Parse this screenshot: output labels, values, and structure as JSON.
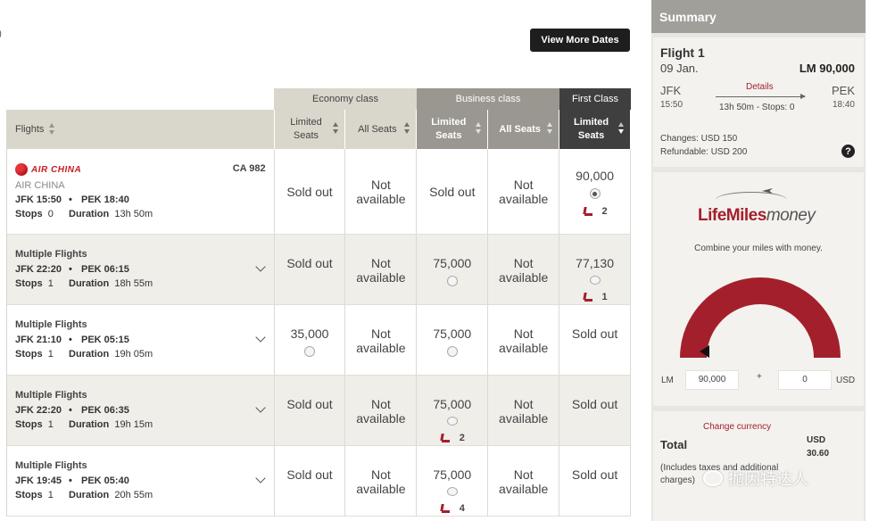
{
  "paren": ")",
  "view_more_label": "View More Dates",
  "classes": {
    "economy": "Economy class",
    "business": "Business class",
    "first": "First Class"
  },
  "columns": {
    "flights": "Flights",
    "eco_limited": "Limited Seats",
    "eco_all": "All Seats",
    "bus_limited": "Limited Seats",
    "bus_all": "All Seats",
    "first_limited": "Limited Seats"
  },
  "colors": {
    "accent_red": "#a41f2c",
    "dark": "#3f3f3f",
    "business_grey": "#9a9790",
    "economy_beige": "#d9d6cc"
  },
  "rows": [
    {
      "airline_logo_text": "AIR CHINA",
      "airline_name": "AIR CHINA",
      "flight_no": "CA 982",
      "dep": "JFK 15:50",
      "arr": "PEK 18:40",
      "stops_label": "Stops",
      "stops": "0",
      "duration_label": "Duration",
      "duration": "13h 50m",
      "cells": [
        "Sold out",
        "Not available",
        "Sold out",
        "Not available",
        "90,000"
      ],
      "first_seats": "2"
    },
    {
      "title": "Multiple Flights",
      "dep": "JFK 22:20",
      "arr": "PEK 06:15",
      "stops_label": "Stops",
      "stops": "1",
      "duration_label": "Duration",
      "duration": "18h 55m",
      "cells": [
        "Sold out",
        "Not available",
        "75,000",
        "Not available",
        "77,130"
      ],
      "first_seats": "1"
    },
    {
      "title": "Multiple Flights",
      "dep": "JFK 21:10",
      "arr": "PEK 05:15",
      "stops_label": "Stops",
      "stops": "1",
      "duration_label": "Duration",
      "duration": "19h 05m",
      "cells": [
        "35,000",
        "Not available",
        "75,000",
        "Not available",
        "Sold out"
      ]
    },
    {
      "title": "Multiple Flights",
      "dep": "JFK 22:20",
      "arr": "PEK 06:35",
      "stops_label": "Stops",
      "stops": "1",
      "duration_label": "Duration",
      "duration": "19h 15m",
      "cells": [
        "Sold out",
        "Not available",
        "75,000",
        "Not available",
        "Sold out"
      ],
      "bus_seats": "2"
    },
    {
      "title": "Multiple Flights",
      "dep": "JFK 19:45",
      "arr": "PEK 05:40",
      "stops_label": "Stops",
      "stops": "1",
      "duration_label": "Duration",
      "duration": "20h 55m",
      "cells": [
        "Sold out",
        "Not available",
        "75,000",
        "Not available",
        "Sold out"
      ],
      "bus_seats": "4"
    }
  ],
  "summary": {
    "header": "Summary",
    "flight_label": "Flight 1",
    "date": "09 Jan.",
    "price": "LM 90,000",
    "from": "JFK",
    "dep_time": "15:50",
    "to": "PEK",
    "arr_time": "18:40",
    "details_link": "Details",
    "duration_stops": "13h 50m - Stops: 0",
    "changes": "Changes: USD 150",
    "refundable": "Refundable: USD 200",
    "help": "?"
  },
  "lifemiles": {
    "logo_brand": "LifeMiles",
    "logo_money": "money",
    "combine_text": "Combine your miles with money.",
    "lm_label": "LM",
    "lm_value": "90,000",
    "plus": "+",
    "usd_value": "0",
    "usd_label": "USD",
    "gauge_fraction": 0
  },
  "total": {
    "change_currency": "Change currency",
    "label": "Total",
    "currency": "USD",
    "amount": "30.60",
    "note": "(Includes taxes and additional charges)",
    "watermark": "抛因特达人"
  }
}
